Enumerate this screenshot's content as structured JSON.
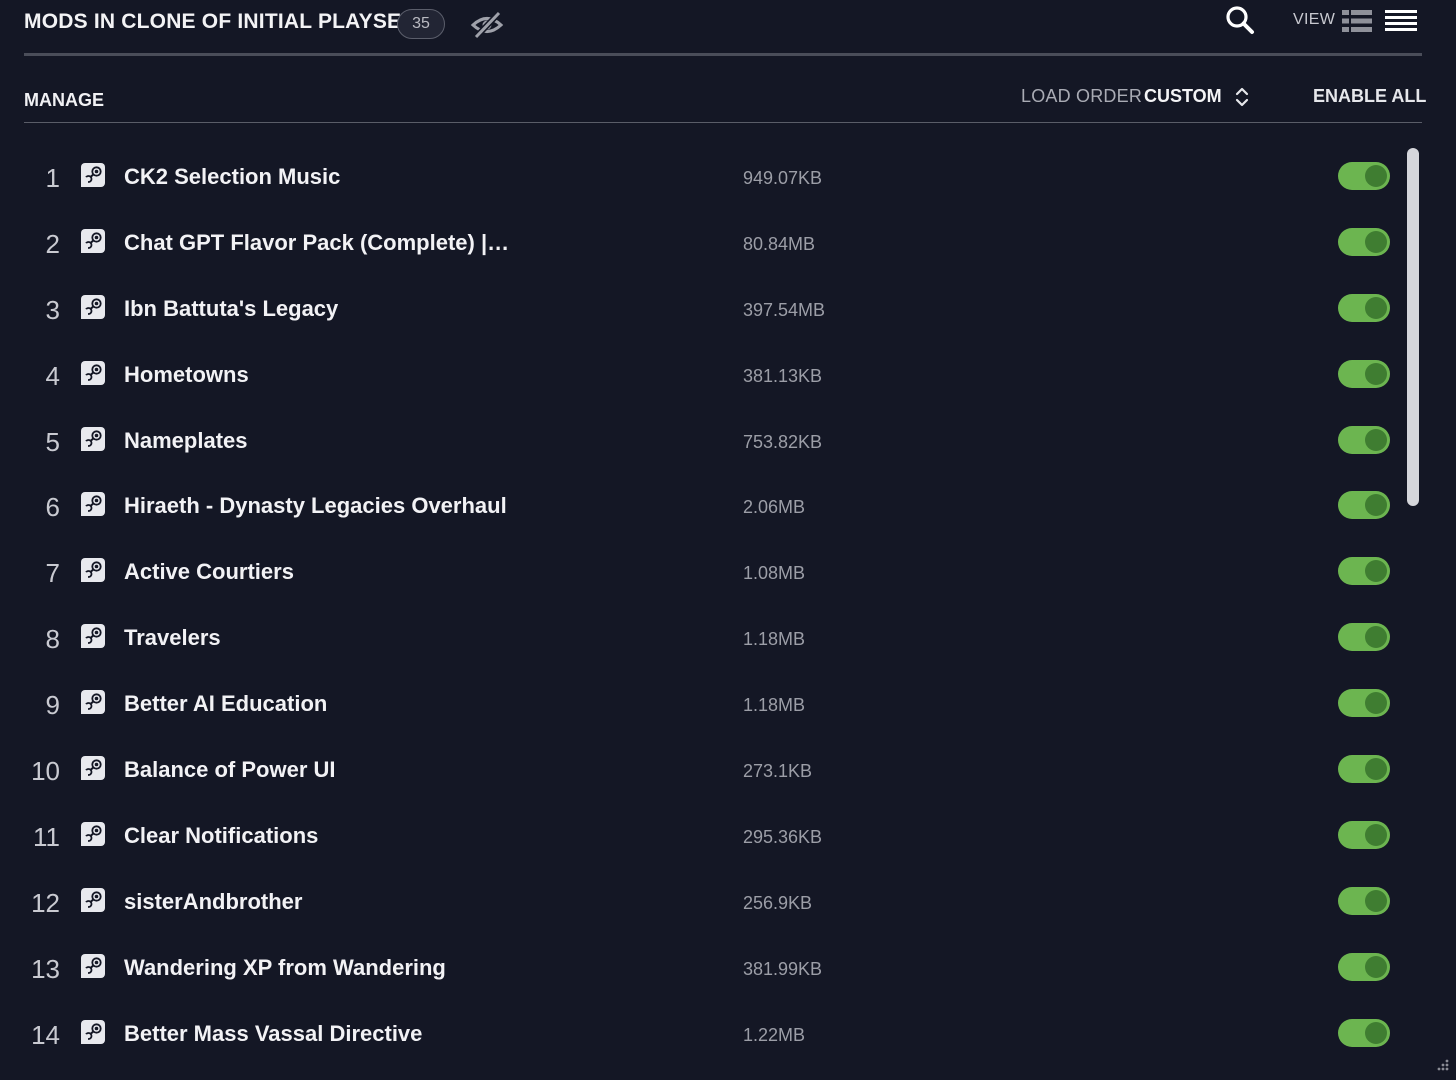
{
  "header": {
    "title": "MODS IN CLONE OF INITIAL PLAYSET",
    "mod_count": "35",
    "view_label": "VIEW",
    "icons": {
      "hide": "eye-slash-icon",
      "search": "search-icon",
      "grid_view": "table-view-icon",
      "list_view": "list-view-icon"
    }
  },
  "toolbar": {
    "manage_label": "MANAGE",
    "load_order_label": "LOAD ORDER",
    "load_order_value": "CUSTOM",
    "enable_all_label": "ENABLE ALL"
  },
  "colors": {
    "background": "#141725",
    "toggle_on": "#6cb550",
    "toggle_knob": "#3f7d31"
  },
  "mods": [
    {
      "index": "1",
      "name": "CK2 Selection Music",
      "size": "949.07KB",
      "enabled": true,
      "source_icon": "steam-icon"
    },
    {
      "index": "2",
      "name": "Chat GPT Flavor Pack (Complete) |…",
      "size": "80.84MB",
      "enabled": true,
      "source_icon": "steam-icon"
    },
    {
      "index": "3",
      "name": "Ibn Battuta's Legacy",
      "size": "397.54MB",
      "enabled": true,
      "source_icon": "steam-icon"
    },
    {
      "index": "4",
      "name": "Hometowns",
      "size": "381.13KB",
      "enabled": true,
      "source_icon": "steam-icon"
    },
    {
      "index": "5",
      "name": "Nameplates",
      "size": "753.82KB",
      "enabled": true,
      "source_icon": "steam-icon"
    },
    {
      "index": "6",
      "name": "Hiraeth - Dynasty Legacies Overhaul",
      "size": "2.06MB",
      "enabled": true,
      "source_icon": "steam-icon"
    },
    {
      "index": "7",
      "name": "Active Courtiers",
      "size": "1.08MB",
      "enabled": true,
      "source_icon": "steam-icon"
    },
    {
      "index": "8",
      "name": "Travelers",
      "size": "1.18MB",
      "enabled": true,
      "source_icon": "steam-icon"
    },
    {
      "index": "9",
      "name": "Better AI Education",
      "size": "1.18MB",
      "enabled": true,
      "source_icon": "steam-icon"
    },
    {
      "index": "10",
      "name": "Balance of Power UI",
      "size": "273.1KB",
      "enabled": true,
      "source_icon": "steam-icon"
    },
    {
      "index": "11",
      "name": "Clear Notifications",
      "size": "295.36KB",
      "enabled": true,
      "source_icon": "steam-icon"
    },
    {
      "index": "12",
      "name": "sisterAndbrother",
      "size": "256.9KB",
      "enabled": true,
      "source_icon": "steam-icon"
    },
    {
      "index": "13",
      "name": "Wandering XP from Wandering",
      "size": "381.99KB",
      "enabled": true,
      "source_icon": "steam-icon"
    },
    {
      "index": "14",
      "name": "Better Mass Vassal Directive",
      "size": "1.22MB",
      "enabled": true,
      "source_icon": "steam-icon"
    }
  ]
}
